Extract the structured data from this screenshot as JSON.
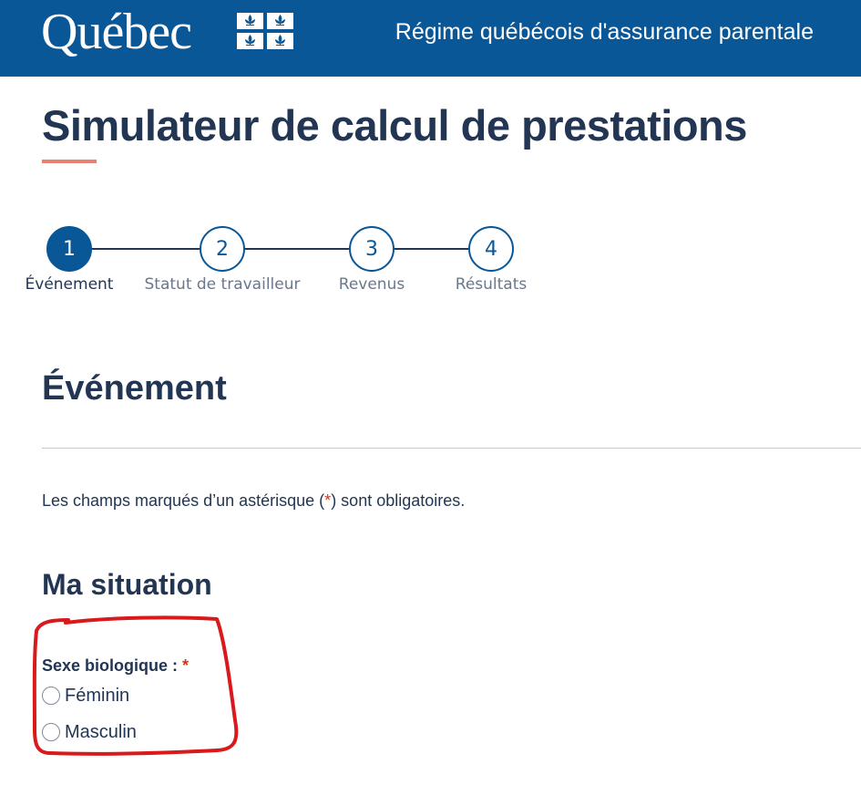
{
  "header": {
    "logo_text": "Québec",
    "logo_icon": "fleurdelise-flag-icon",
    "program_title": "Régime québécois d'assurance parentale"
  },
  "page": {
    "title": "Simulateur de calcul de prestations"
  },
  "stepper": {
    "steps": [
      {
        "number": "1",
        "label": "Événement",
        "active": true
      },
      {
        "number": "2",
        "label": "Statut de travailleur",
        "active": false
      },
      {
        "number": "3",
        "label": "Revenus",
        "active": false
      },
      {
        "number": "4",
        "label": "Résultats",
        "active": false
      }
    ]
  },
  "section": {
    "heading": "Événement",
    "required_note_before": "Les champs marqués d’un astérisque (",
    "required_note_asterisk": "*",
    "required_note_after": ") sont obligatoires.",
    "subsection": "Ma situation"
  },
  "form": {
    "sex_label": "Sexe biologique : ",
    "required_mark": "*",
    "options": [
      {
        "label": "Féminin",
        "checked": false
      },
      {
        "label": "Masculin",
        "checked": false
      }
    ]
  },
  "colors": {
    "header_bg": "#095797",
    "title_text": "#223654",
    "accent_underline": "#e58271",
    "required_red": "#cb381f",
    "annotation_red": "#d9191c"
  }
}
